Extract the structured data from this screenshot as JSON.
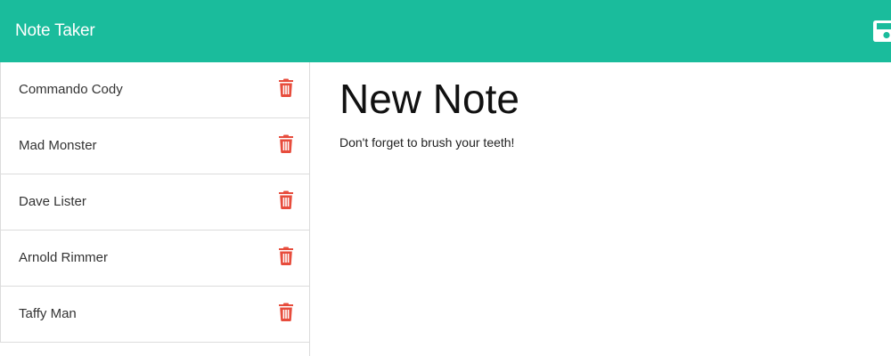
{
  "app": {
    "title": "Note Taker"
  },
  "header": {
    "save_icon": "floppy-disk-icon"
  },
  "sidebar": {
    "notes": [
      {
        "title": "Commando Cody",
        "delete_icon": "trash-icon"
      },
      {
        "title": "Mad Monster",
        "delete_icon": "trash-icon"
      },
      {
        "title": "Dave Lister",
        "delete_icon": "trash-icon"
      },
      {
        "title": "Arnold Rimmer",
        "delete_icon": "trash-icon"
      },
      {
        "title": "Taffy Man",
        "delete_icon": "trash-icon"
      }
    ]
  },
  "editor": {
    "title": "New Note",
    "body": "Don't forget to brush your teeth!"
  },
  "colors": {
    "accent": "#1abc9c",
    "delete": "#e74c3c"
  }
}
